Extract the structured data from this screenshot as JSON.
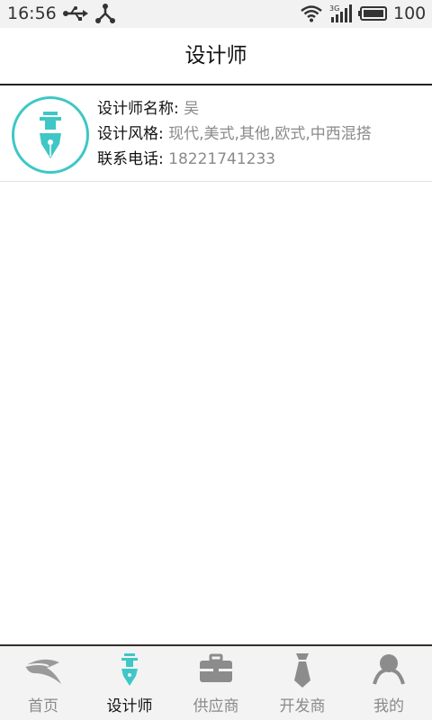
{
  "status_bar": {
    "time": "16:56",
    "battery_text": "100",
    "icons": [
      "usb-icon",
      "share-icon",
      "wifi-icon",
      "signal-3g-icon",
      "battery-icon"
    ]
  },
  "header": {
    "title": "设计师"
  },
  "designer": {
    "avatar_icon": "pen-nib-icon",
    "name_label": "设计师名称:",
    "name_value": "吴",
    "style_label": "设计风格:",
    "style_value": "现代,美式,其他,欧式,中西混搭",
    "phone_label": "联系电话:",
    "phone_value": "18221741233"
  },
  "tabs": [
    {
      "label": "首页",
      "icon": "home-icon",
      "active": false
    },
    {
      "label": "设计师",
      "icon": "pen-nib-icon",
      "active": true
    },
    {
      "label": "供应商",
      "icon": "briefcase-icon",
      "active": false
    },
    {
      "label": "开发商",
      "icon": "tie-icon",
      "active": false
    },
    {
      "label": "我的",
      "icon": "user-icon",
      "active": false
    }
  ],
  "colors": {
    "accent": "#3ec7c6",
    "inactive": "#8a8a8a"
  }
}
